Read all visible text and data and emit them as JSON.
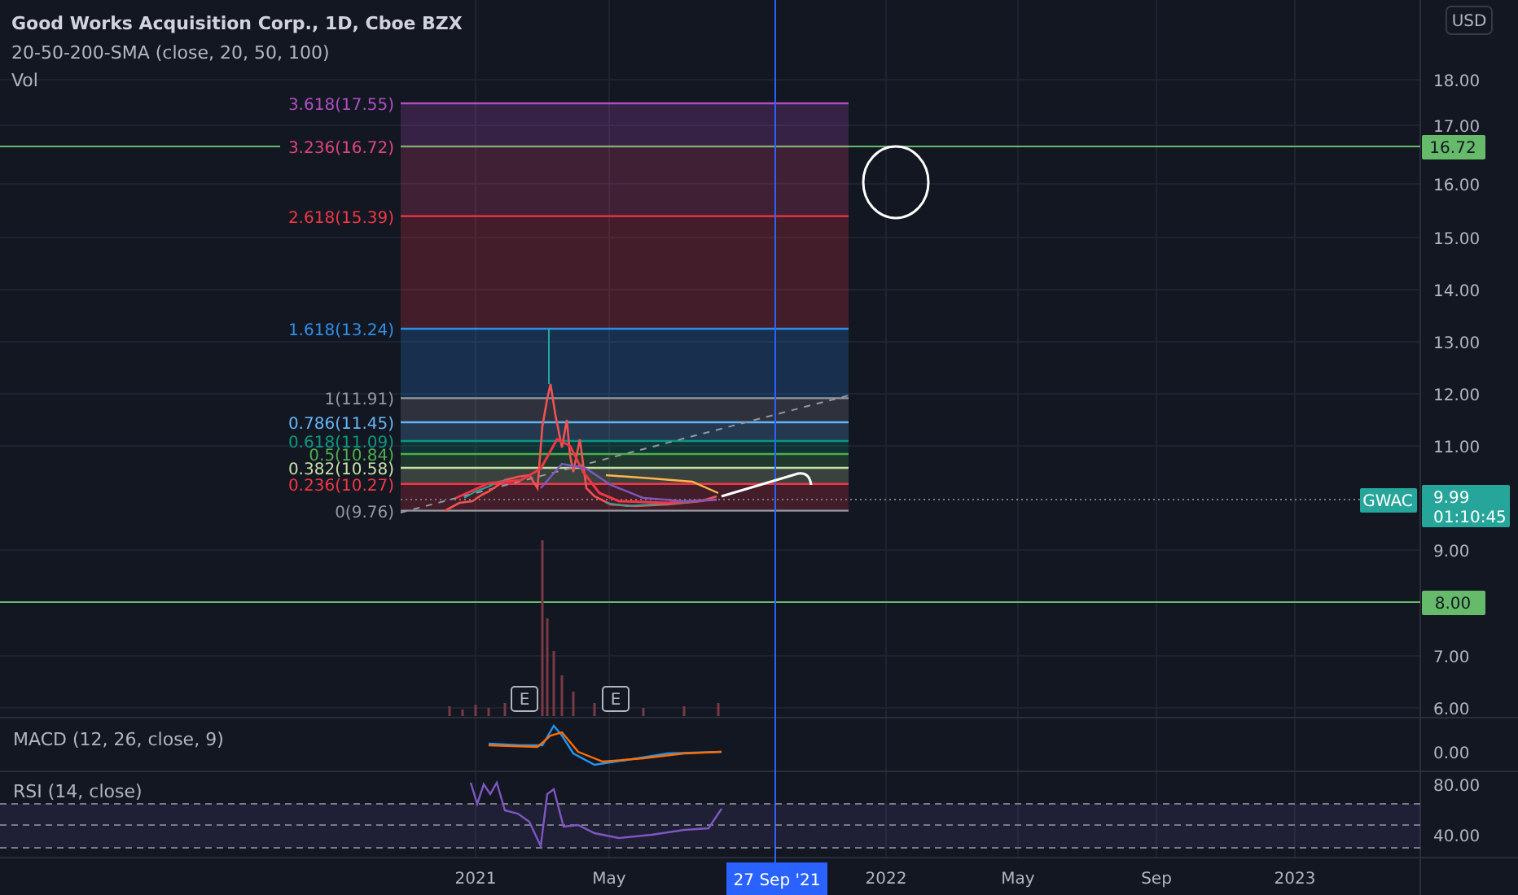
{
  "legend": {
    "title": "Good Works Acquisition Corp., 1D, Cboe BZX",
    "indicator": "20-50-200-SMA (close, 20, 50, 100)",
    "volume": "Vol"
  },
  "fib_levels": [
    {
      "label": "3.618(17.55)",
      "color": "#b04ec4"
    },
    {
      "label": "3.236(16.72)",
      "color": "#e0457b"
    },
    {
      "label": "2.618(15.39)",
      "color": "#f23645"
    },
    {
      "label": "1.618(13.24)",
      "color": "#2f8fe8"
    },
    {
      "label": "1(11.91)",
      "color": "#9598a1"
    },
    {
      "label": "0.786(11.45)",
      "color": "#64b5f6"
    },
    {
      "label": "0.618(11.09)",
      "color": "#089981"
    },
    {
      "label": "0.5(10.84)",
      "color": "#4caf50"
    },
    {
      "label": "0.382(10.58)",
      "color": "#c5e1a5"
    },
    {
      "label": "0.236(10.27)",
      "color": "#f23645"
    },
    {
      "label": "0(9.76)",
      "color": "#9598a1"
    }
  ],
  "price_axis": {
    "currency": "USD",
    "ticks": [
      "18.00",
      "17.00",
      "16.00",
      "15.00",
      "14.00",
      "13.00",
      "12.00",
      "11.00",
      "9.00",
      "7.00",
      "6.00"
    ]
  },
  "price_badges": [
    "16.72",
    "8.00"
  ],
  "symbol": {
    "ticker": "GWAC",
    "price": "9.99",
    "countdown": "01:10:45"
  },
  "earnings_markers": [
    "E",
    "E"
  ],
  "macd": {
    "label": "MACD (12, 26, close, 9)",
    "tick": "0.00"
  },
  "rsi": {
    "label": "RSI (14, close)",
    "ticks": [
      "80.00",
      "40.00"
    ]
  },
  "time_axis": {
    "labels": [
      "2021",
      "May",
      "2022",
      "May",
      "Sep",
      "2023"
    ],
    "cursor": "27 Sep '21"
  }
}
